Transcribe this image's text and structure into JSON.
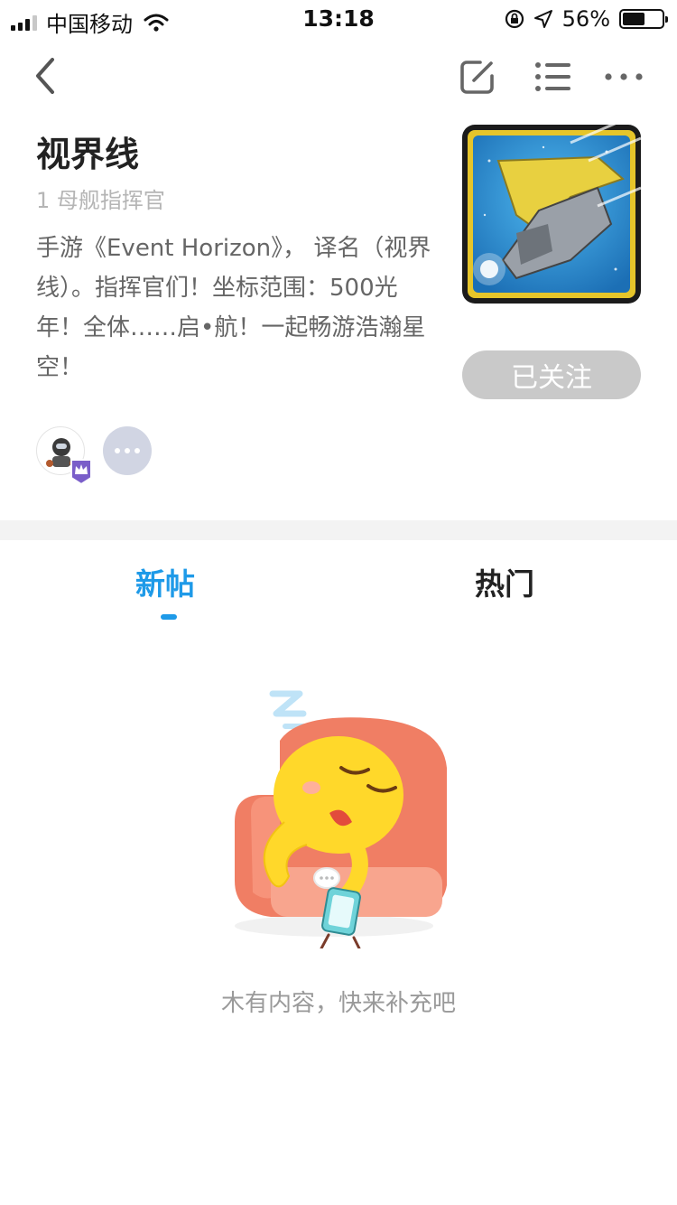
{
  "status_bar": {
    "carrier": "中国移动",
    "time": "13:18",
    "battery_percent": "56%",
    "battery_level": 0.56
  },
  "nav": {
    "icons": [
      "back-icon",
      "edit-icon",
      "list-icon",
      "more-icon"
    ]
  },
  "community": {
    "title": "视界线",
    "subtitle": "1 母舰指挥官",
    "description": "手游《Event Horizon》， 译名（视界线）。指挥官们！坐标范围：500光年！全体……启•航！一起畅游浩瀚星空！",
    "follow_button": "已关注"
  },
  "tabs": [
    {
      "label": "新帖",
      "active": true
    },
    {
      "label": "热门",
      "active": false
    }
  ],
  "empty_state": {
    "message": "木有内容，快来补充吧"
  },
  "colors": {
    "accent": "#1e9ae8",
    "follow_button_bg": "#c9c9c9",
    "divider": "#f3f3f3"
  }
}
